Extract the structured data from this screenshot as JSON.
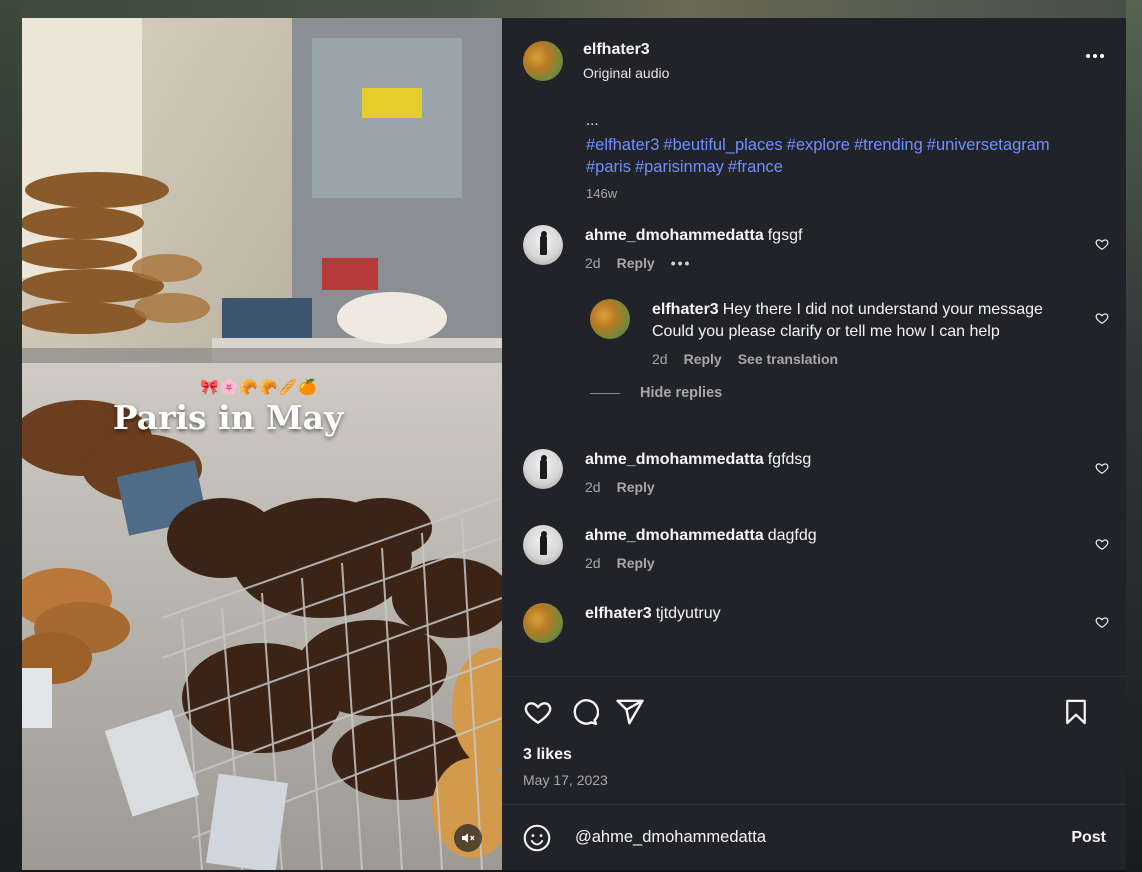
{
  "post": {
    "username": "elfhater3",
    "audio": "Original audio",
    "overlay_title": "Paris in May",
    "overlay_emoji": "🎀🌸🥐🥐🥖🍊"
  },
  "caption": {
    "ellipsis": "...",
    "hashtags": [
      "#elfhater3",
      "#beutiful_places",
      "#explore",
      "#trending",
      "#universetagram",
      "#paris",
      "#parisinmay",
      "#france"
    ],
    "time": "146w"
  },
  "comments": [
    {
      "user": "ahme_dmohammedatta",
      "text": "fgsgf",
      "time": "2d",
      "reply_label": "Reply"
    },
    {
      "user": "elfhater3",
      "text": "Hey there I did not understand your message Could you please clarify or tell me how I can help",
      "time": "2d",
      "reply_label": "Reply",
      "translate_label": "See translation"
    },
    {
      "user": "ahme_dmohammedatta",
      "text": "fgfdsg",
      "time": "2d",
      "reply_label": "Reply"
    },
    {
      "user": "ahme_dmohammedatta",
      "text": "dagfdg",
      "time": "2d",
      "reply_label": "Reply"
    },
    {
      "user": "elfhater3",
      "text": "tjtdyutruy"
    }
  ],
  "hide_replies": "Hide replies",
  "footer": {
    "likes": "3 likes",
    "date": "May 17, 2023",
    "comment_value": "@ahme_dmohammedatta",
    "post_label": "Post"
  },
  "icons": [
    "more-icon",
    "heart-icon",
    "comment-icon",
    "share-icon",
    "save-icon",
    "emoji-icon",
    "mute-icon"
  ],
  "colors": {
    "hashtag": "#6f8fff",
    "panel_bg": "#212328",
    "muted_text": "#a8a8a8"
  }
}
